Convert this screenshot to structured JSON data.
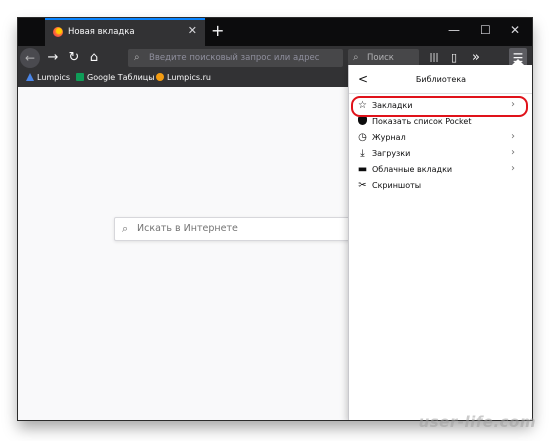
{
  "tab": {
    "title": "Новая вкладка",
    "close": "✕"
  },
  "toolbar": {
    "new_tab": "+",
    "minimize": "—",
    "maximize": "☐",
    "close": "✕",
    "back": "←",
    "forward": "→",
    "reload": "↻",
    "home": "⌂",
    "url_placeholder": "Введите поисковый запрос или адрес",
    "search_placeholder": "Поиск",
    "library": "|||",
    "sidebar": "▯",
    "overflow": "»",
    "menu": "☰"
  },
  "bookmarks": [
    {
      "label": "Lumpics",
      "icon": "lumpics-icon",
      "color": "#4a86e8"
    },
    {
      "label": "Google Таблицы",
      "icon": "sheets-icon",
      "color": "#0f9d58"
    },
    {
      "label": "Lumpics.ru",
      "icon": "orange-circle-icon",
      "color": "#f39c12"
    }
  ],
  "content": {
    "search_placeholder": "Искать в Интернете"
  },
  "panel": {
    "title": "Библиотека",
    "back": "<",
    "items": [
      {
        "label": "Закладки",
        "icon": "star-icon",
        "glyph": "☆",
        "chevron": "›",
        "highlighted": true
      },
      {
        "label": "Показать список Pocket",
        "icon": "pocket-icon",
        "glyph": "◥",
        "chevron": ""
      },
      {
        "label": "Журнал",
        "icon": "clock-icon",
        "glyph": "◷",
        "chevron": "›"
      },
      {
        "label": "Загрузки",
        "icon": "download-icon",
        "glyph": "⤓",
        "chevron": "›"
      },
      {
        "label": "Облачные вкладки",
        "icon": "laptop-icon",
        "glyph": "▬",
        "chevron": "›"
      },
      {
        "label": "Скриншоты",
        "icon": "screenshot-icon",
        "glyph": "✂",
        "chevron": ""
      }
    ],
    "highlight_color": "#e0121a"
  },
  "watermark": "user-life.com",
  "colors": {
    "accent": "#0a84ff",
    "tabbar": "#0c0c0d",
    "toolbar": "#323234"
  }
}
